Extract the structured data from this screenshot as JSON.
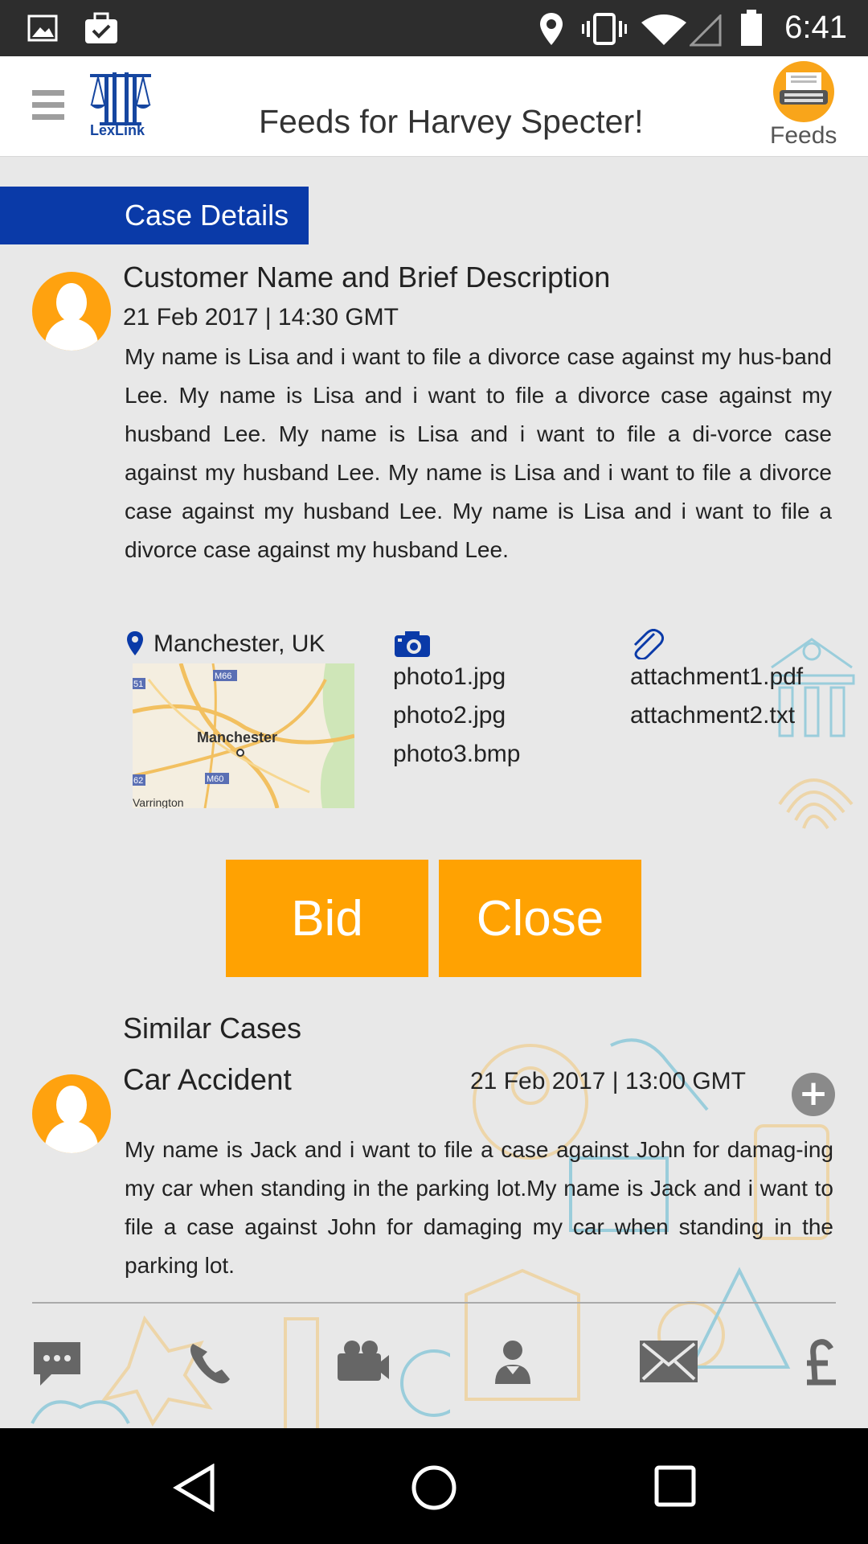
{
  "status_bar": {
    "time": "6:41"
  },
  "app_bar": {
    "logo_text": "LexLink",
    "title": "Feeds for Harvey Specter!",
    "feeds_label": "Feeds"
  },
  "case_tab": "Case Details",
  "case": {
    "title": "Customer Name and Brief Description",
    "date": "21 Feb 2017 | 14:30 GMT",
    "description": "My name is Lisa and i want to file a divorce case against my hus-band Lee. My name is Lisa and i want to file a divorce case against my husband Lee. My name is Lisa and i want to file a di-vorce case against my husband Lee. My name is Lisa and i want to file a divorce case against my husband Lee. My name is Lisa and i want to file a divorce case against my husband Lee.",
    "location": "Manchester, UK",
    "map_labels": {
      "city": "Manchester",
      "m66": "M66",
      "m60": "M60",
      "m61": "51",
      "m62": "62",
      "town": "Varrington"
    },
    "photos": [
      "photo1.jpg",
      "photo2.jpg",
      "photo3.bmp"
    ],
    "attachments": [
      "attachment1.pdf",
      "attachment2.txt"
    ]
  },
  "actions": {
    "bid": "Bid",
    "close": "Close"
  },
  "similar": {
    "heading": "Similar Cases",
    "items": [
      {
        "title": "Car Accident",
        "date": "21 Feb 2017 | 13:00 GMT",
        "description": "My name is Jack and i want to file a case against John for damag-ing my car when standing in the parking lot.My name is Jack and i want to file a case against John for damaging my car when standing in the parking lot."
      }
    ]
  },
  "bottom_icons": [
    "chat-icon",
    "phone-icon",
    "video-camera-icon",
    "user-download-icon",
    "mail-icon",
    "pound-icon"
  ],
  "colors": {
    "accent_orange": "#ffa202",
    "tab_blue": "#0a3aa8",
    "logo_blue": "#1646a0"
  }
}
